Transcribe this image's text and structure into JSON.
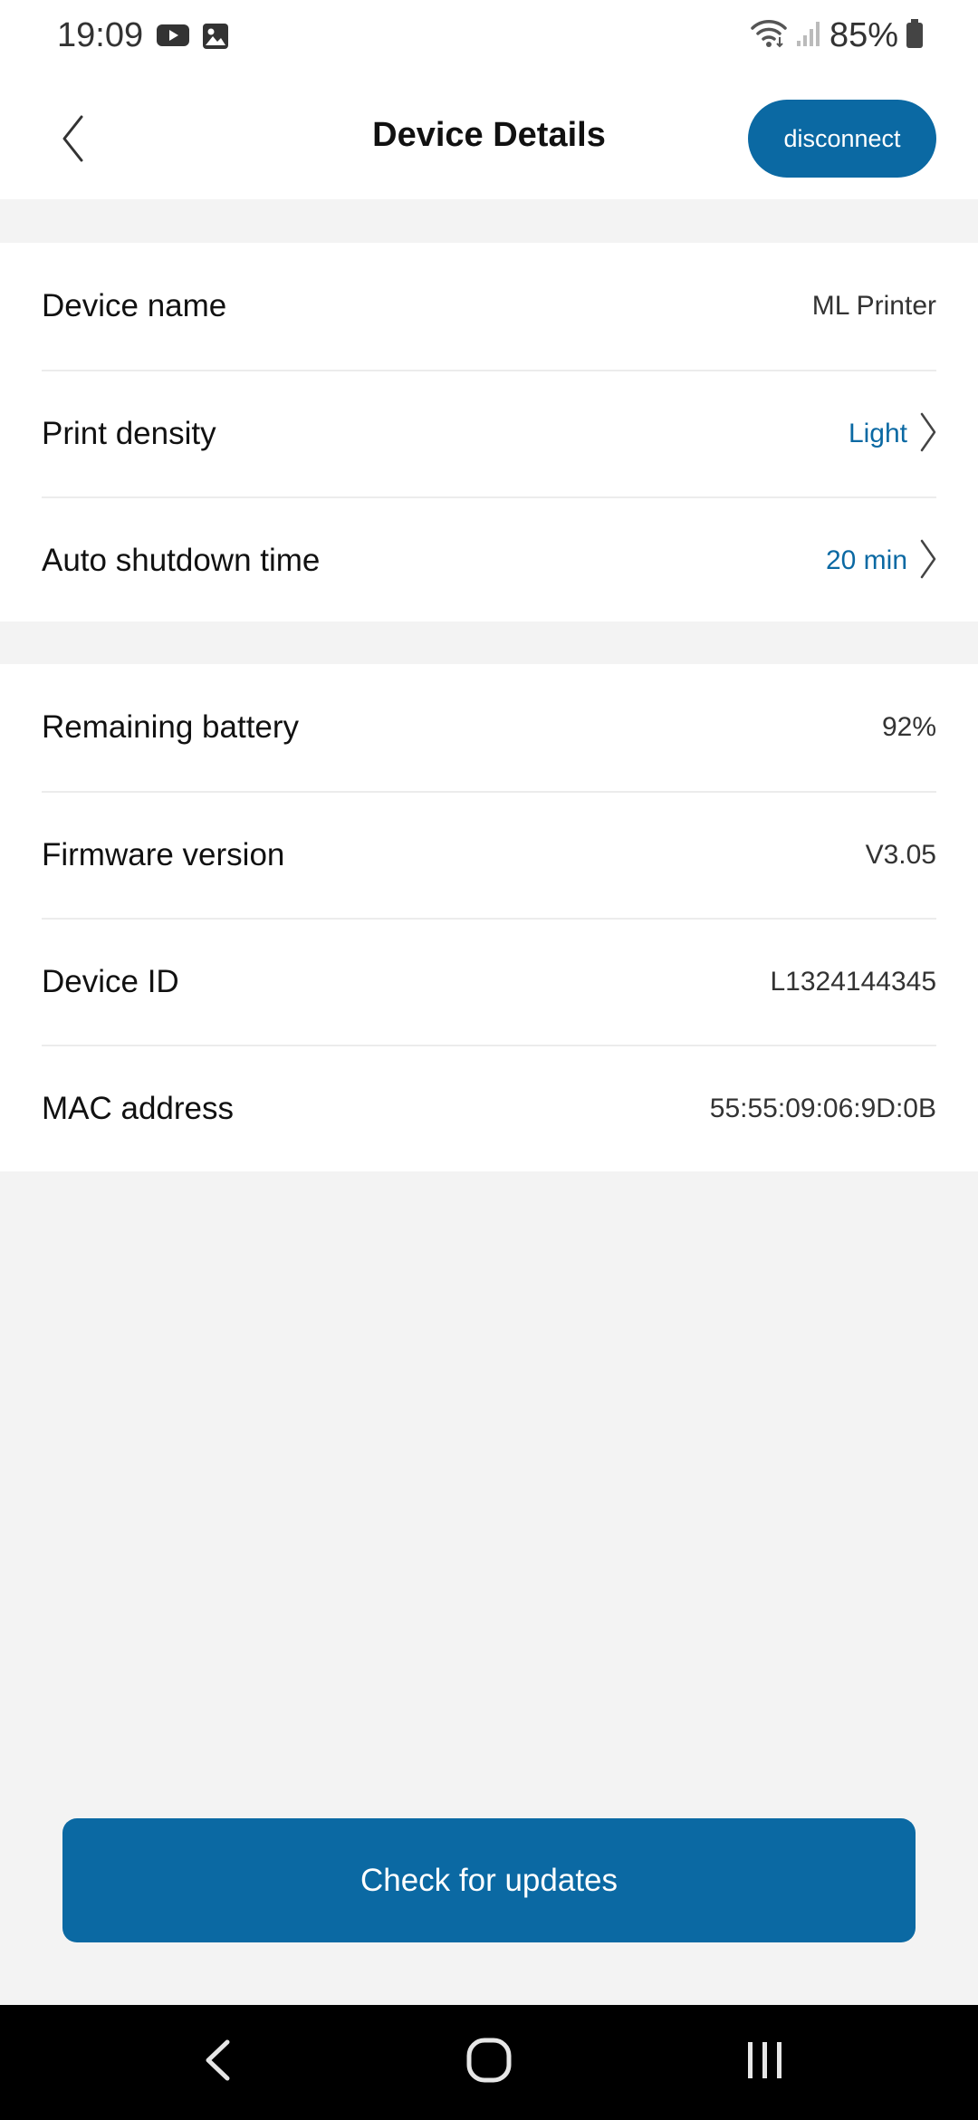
{
  "status_bar": {
    "time": "19:09",
    "battery": "85%",
    "icons": [
      "youtube-icon",
      "gallery-icon",
      "wifi-icon",
      "signal-icon",
      "battery-icon"
    ]
  },
  "header": {
    "title": "Device Details",
    "back_icon": "chevron-left-icon",
    "disconnect_label": "disconnect"
  },
  "settings": [
    {
      "label": "Device name",
      "value": "ML Printer",
      "clickable": false
    },
    {
      "label": "Print density",
      "value": "Light",
      "clickable": true
    },
    {
      "label": "Auto shutdown time",
      "value": "20 min",
      "clickable": true
    }
  ],
  "info": [
    {
      "label": "Remaining battery",
      "value": "92%"
    },
    {
      "label": "Firmware version",
      "value": "V3.05"
    },
    {
      "label": "Device ID",
      "value": "L1324144345"
    },
    {
      "label": "MAC address",
      "value": "55:55:09:06:9D:0B"
    }
  ],
  "update_button_label": "Check for updates",
  "colors": {
    "accent": "#0b69a3",
    "background": "#f3f3f3",
    "surface": "#ffffff"
  }
}
